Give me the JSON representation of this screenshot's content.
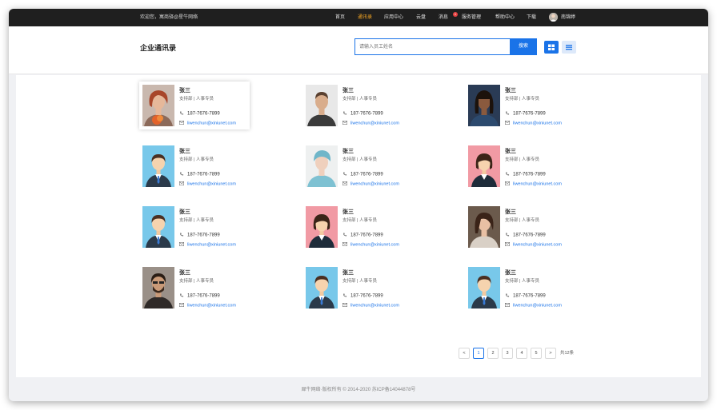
{
  "topnav": {
    "welcome": "欢迎您，寓商驿@星牛网络",
    "items": [
      {
        "label": "首页"
      },
      {
        "label": "通讯录"
      },
      {
        "label": "应用中心"
      },
      {
        "label": "云盘"
      },
      {
        "label": "消息",
        "badge": "1"
      },
      {
        "label": "服务管理"
      },
      {
        "label": "帮助中心"
      },
      {
        "label": "下载"
      }
    ],
    "active_index": 1,
    "user_name": "南锦婷"
  },
  "header": {
    "title": "企业通讯录",
    "search_placeholder": "请输入员工姓名",
    "search_button": "搜索"
  },
  "contacts": [
    {
      "name": "张三",
      "dept": "支持部 | 人事专员",
      "phone": "187-7676-7899",
      "email": "liwenchun@xiniunet.com",
      "avatar": "photo-woman-red"
    },
    {
      "name": "张三",
      "dept": "支持部 | 人事专员",
      "phone": "187-7676-7899",
      "email": "liwenchun@xiniunet.com",
      "avatar": "photo-man"
    },
    {
      "name": "张三",
      "dept": "支持部 | 人事专员",
      "phone": "187-7676-7899",
      "email": "liwenchun@xiniunet.com",
      "avatar": "photo-woman-dark"
    },
    {
      "name": "张三",
      "dept": "支持部 | 人事专员",
      "phone": "187-7676-7899",
      "email": "liwenchun@xiniunet.com",
      "avatar": "male-default"
    },
    {
      "name": "张三",
      "dept": "支持部 | 人事专员",
      "phone": "187-7676-7899",
      "email": "liwenchun@xiniunet.com",
      "avatar": "photo-woman-hat"
    },
    {
      "name": "张三",
      "dept": "支持部 | 人事专员",
      "phone": "187-7676-7899",
      "email": "liwenchun@xiniunet.com",
      "avatar": "female-default"
    },
    {
      "name": "张三",
      "dept": "支持部 | 人事专员",
      "phone": "187-7676-7899",
      "email": "liwenchun@xiniunet.com",
      "avatar": "male-default"
    },
    {
      "name": "张三",
      "dept": "支持部 | 人事专员",
      "phone": "187-7676-7899",
      "email": "liwenchun@xiniunet.com",
      "avatar": "female-default"
    },
    {
      "name": "张三",
      "dept": "支持部 | 人事专员",
      "phone": "187-7676-7899",
      "email": "liwenchun@xiniunet.com",
      "avatar": "photo-woman-asian"
    },
    {
      "name": "张三",
      "dept": "支持部 | 人事专员",
      "phone": "187-7676-7899",
      "email": "liwenchun@xiniunet.com",
      "avatar": "photo-man-beard"
    },
    {
      "name": "张三",
      "dept": "支持部 | 人事专员",
      "phone": "187-7676-7899",
      "email": "liwenchun@xiniunet.com",
      "avatar": "male-default"
    },
    {
      "name": "张三",
      "dept": "支持部 | 人事专员",
      "phone": "187-7676-7899",
      "email": "liwenchun@xiniunet.com",
      "avatar": "male-default"
    }
  ],
  "pagination": {
    "prev": "<",
    "pages": [
      "1",
      "2",
      "3",
      "4",
      "5"
    ],
    "current": "1",
    "next": ">",
    "total": "共12条"
  },
  "footer": {
    "text": "犀牛网络·版权所有 © 2014-2020 苏ICP备14044878号"
  },
  "colors": {
    "accent": "#1a73e8",
    "nav_bg": "#1f1f1f",
    "nav_active": "#f5a623",
    "badge": "#e84343"
  }
}
